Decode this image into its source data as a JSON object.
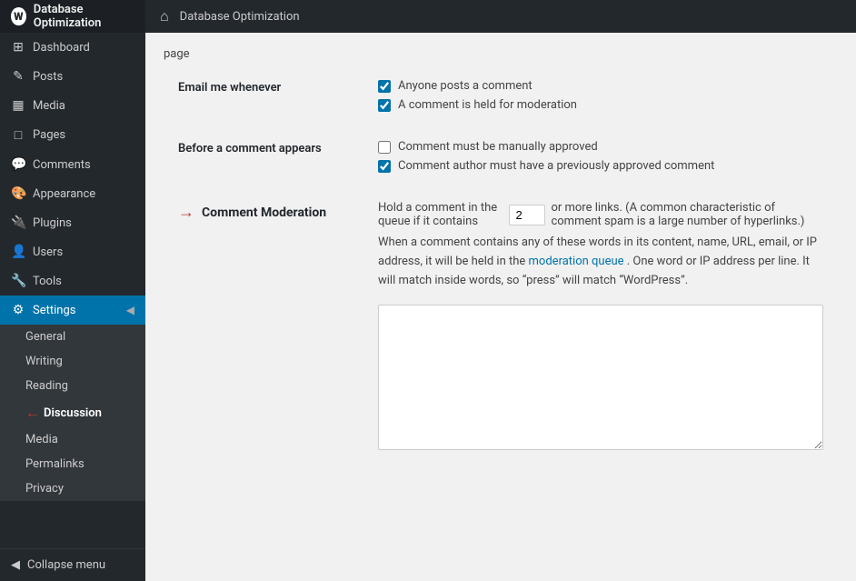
{
  "adminBar": {
    "title": "Database Optimization",
    "houseIcon": "⌂"
  },
  "sidebar": {
    "items": [
      {
        "label": "Dashboard",
        "icon": "⊞",
        "name": "dashboard"
      },
      {
        "label": "Posts",
        "icon": "✎",
        "name": "posts"
      },
      {
        "label": "Media",
        "icon": "▦",
        "name": "media"
      },
      {
        "label": "Pages",
        "icon": "□",
        "name": "pages"
      },
      {
        "label": "Comments",
        "icon": "💬",
        "name": "comments"
      },
      {
        "label": "Appearance",
        "icon": "🎨",
        "name": "appearance"
      },
      {
        "label": "Plugins",
        "icon": "⚙",
        "name": "plugins"
      },
      {
        "label": "Users",
        "icon": "👤",
        "name": "users"
      },
      {
        "label": "Tools",
        "icon": "🔧",
        "name": "tools"
      },
      {
        "label": "Settings",
        "icon": "⚙",
        "name": "settings"
      }
    ],
    "settingsSubItems": [
      {
        "label": "General",
        "name": "general"
      },
      {
        "label": "Writing",
        "name": "writing"
      },
      {
        "label": "Reading",
        "name": "reading"
      },
      {
        "label": "Discussion",
        "name": "discussion"
      },
      {
        "label": "Media",
        "name": "media"
      },
      {
        "label": "Permalinks",
        "name": "permalinks"
      },
      {
        "label": "Privacy",
        "name": "privacy"
      }
    ],
    "collapseLabel": "Collapse menu"
  },
  "content": {
    "pageRef": "page",
    "emailSection": {
      "label": "Email me whenever",
      "options": [
        {
          "label": "Anyone posts a comment",
          "checked": true
        },
        {
          "label": "A comment is held for moderation",
          "checked": true
        }
      ]
    },
    "beforeCommentSection": {
      "label": "Before a comment appears",
      "options": [
        {
          "label": "Comment must be manually approved",
          "checked": false
        },
        {
          "label": "Comment author must have a previously approved comment",
          "checked": true
        }
      ]
    },
    "commentModeration": {
      "label": "Comment Moderation",
      "holdText1": "Hold a comment in the queue if it contains",
      "holdValue": "2",
      "holdText2": "or more links. (A common characteristic of comment spam is a large number of hyperlinks.)",
      "desc1": "When a comment contains any of these words in its content, name, URL, email, or IP address, it will be held in the",
      "linkLabel": "moderation queue",
      "desc2": ". One word or IP address per line. It will match inside words, so “press” will match “WordPress”.",
      "textareaPlaceholder": ""
    }
  }
}
